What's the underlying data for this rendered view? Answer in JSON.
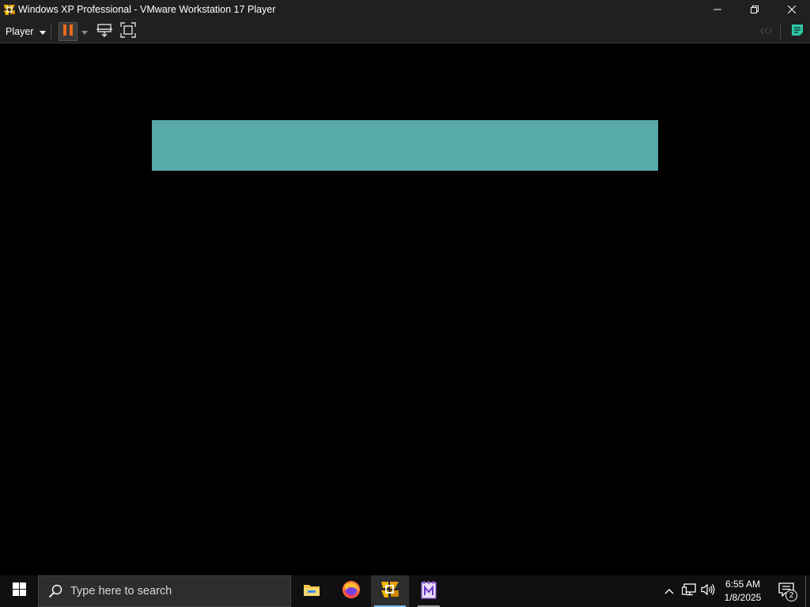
{
  "window": {
    "title": "Windows XP Professional - VMware Workstation 17 Player",
    "icon": "vmware-player-icon",
    "controls": [
      "minimize-icon",
      "restore-icon",
      "close-icon"
    ]
  },
  "toolbar": {
    "player_menu_label": "Player",
    "buttons": [
      "pause-icon",
      "dropdown-arrow-icon",
      "send-ctrl-alt-del-icon",
      "fullscreen-icon",
      "unity-icon",
      "message-log-icon"
    ]
  },
  "vm": {
    "bar_color": "#59aaaa",
    "background_color": "#000000"
  },
  "taskbar": {
    "search_placeholder": "Type here to search",
    "apps": [
      {
        "name": "file-explorer",
        "icon": "folder-icon",
        "active": false
      },
      {
        "name": "firefox",
        "icon": "firefox-icon",
        "active": false
      },
      {
        "name": "vmware-player",
        "icon": "vmware-player-icon",
        "active": true
      },
      {
        "name": "notepad-plus",
        "icon": "notepad-icon",
        "active": false
      }
    ],
    "tray_icons": [
      "chevron-up-icon",
      "network-icon",
      "volume-icon"
    ],
    "clock": {
      "time": "6:55 AM",
      "date": "1/8/2025"
    },
    "notification_count": "2",
    "accent": "#76b9ed"
  }
}
